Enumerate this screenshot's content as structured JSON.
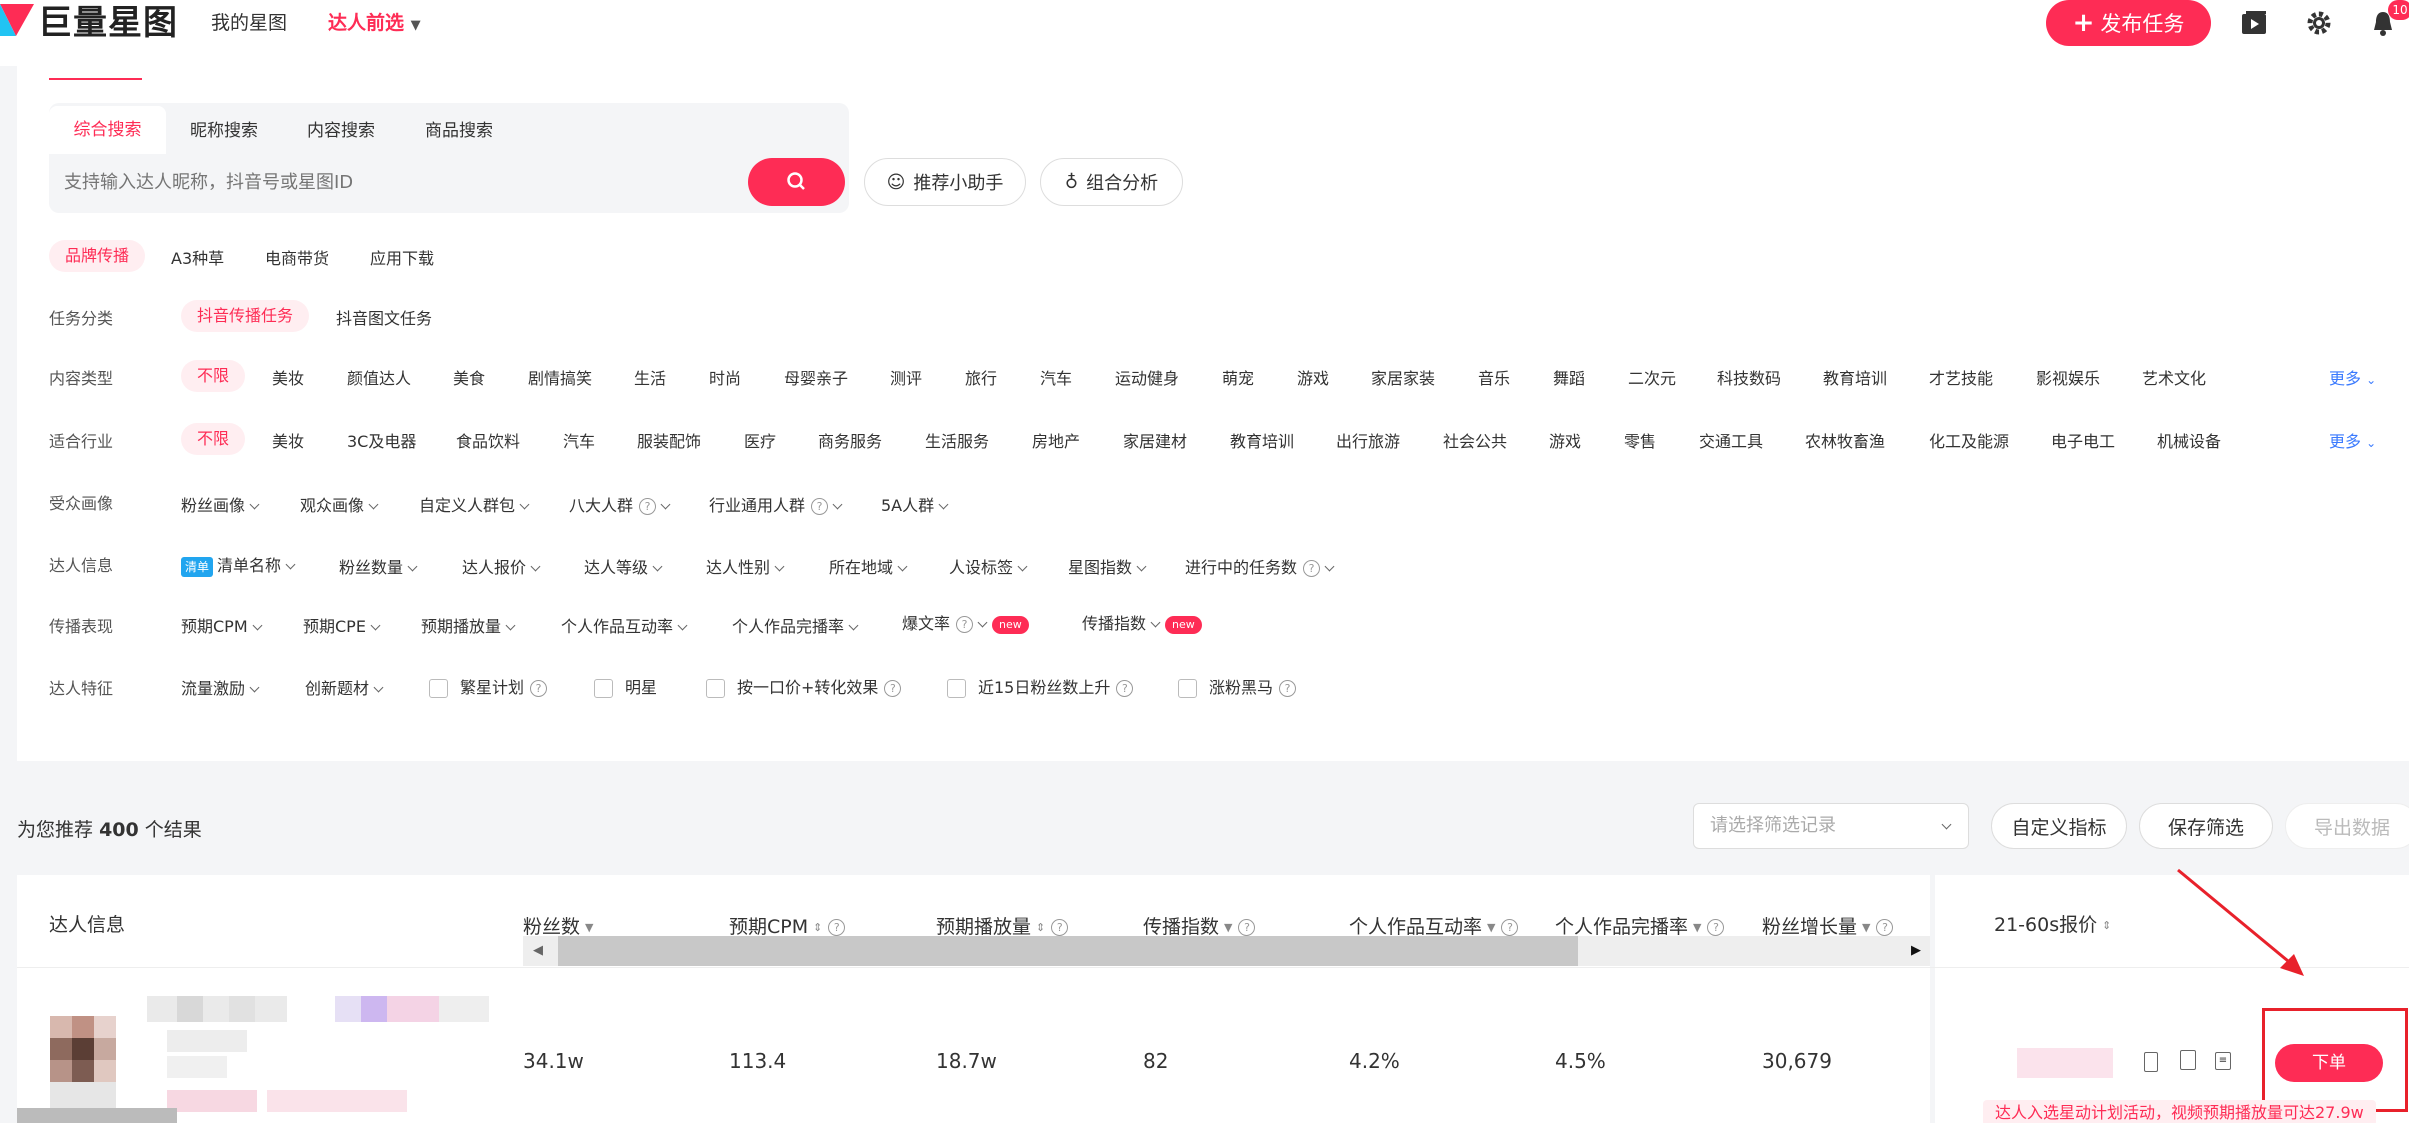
{
  "brand": {
    "logo_text": "巨量星图",
    "accent": "#fe2c55"
  },
  "nav": {
    "my_star": "我的星图",
    "talent_preselect": "达人前选",
    "publish": "发布任务",
    "notification_count": "10"
  },
  "search": {
    "tabs": [
      "综合搜索",
      "昵称搜索",
      "内容搜索",
      "商品搜索"
    ],
    "placeholder": "支持输入达人昵称，抖音号或星图ID",
    "assistant": "推荐小助手",
    "combo": "组合分析"
  },
  "categories": [
    "品牌传播",
    "A3种草",
    "电商带货",
    "应用下载"
  ],
  "task_type": {
    "label": "任务分类",
    "options": [
      "抖音传播任务",
      "抖音图文任务"
    ]
  },
  "content_type": {
    "label": "内容类型",
    "options": [
      "不限",
      "美妆",
      "颜值达人",
      "美食",
      "剧情搞笑",
      "生活",
      "时尚",
      "母婴亲子",
      "测评",
      "旅行",
      "汽车",
      "运动健身",
      "萌宠",
      "游戏",
      "家居家装",
      "音乐",
      "舞蹈",
      "二次元",
      "科技数码",
      "教育培训",
      "才艺技能",
      "影视娱乐",
      "艺术文化"
    ],
    "more": "更多"
  },
  "industry": {
    "label": "适合行业",
    "options": [
      "不限",
      "美妆",
      "3C及电器",
      "食品饮料",
      "汽车",
      "服装配饰",
      "医疗",
      "商务服务",
      "生活服务",
      "房地产",
      "家居建材",
      "教育培训",
      "出行旅游",
      "社会公共",
      "游戏",
      "零售",
      "交通工具",
      "农林牧畜渔",
      "化工及能源",
      "电子电工",
      "机械设备"
    ],
    "more": "更多"
  },
  "audience": {
    "label": "受众画像",
    "options": [
      "粉丝画像",
      "观众画像",
      "自定义人群包",
      "八大人群",
      "行业通用人群",
      "5A人群"
    ]
  },
  "talent_info": {
    "label": "达人信息",
    "list_badge": "清单",
    "options": [
      "清单名称",
      "粉丝数量",
      "达人报价",
      "达人等级",
      "达人性别",
      "所在地域",
      "人设标签",
      "星图指数",
      "进行中的任务数"
    ]
  },
  "performance": {
    "label": "传播表现",
    "options": [
      "预期CPM",
      "预期CPE",
      "预期播放量",
      "个人作品互动率",
      "个人作品完播率",
      "爆文率",
      "传播指数"
    ],
    "new": "new"
  },
  "features": {
    "label": "达人特征",
    "options": [
      "流量激励",
      "创新题材"
    ],
    "checks": [
      "繁星计划",
      "明星",
      "按一口价+转化效果",
      "近15日粉丝数上升",
      "涨粉黑马"
    ]
  },
  "results": {
    "prefix": "为您推荐",
    "count": "400",
    "suffix": "个结果",
    "record_placeholder": "请选择筛选记录",
    "custom_metric": "自定义指标",
    "save_filter": "保存筛选",
    "export": "导出数据"
  },
  "table": {
    "headers": [
      "达人信息",
      "粉丝数",
      "预期CPM",
      "预期播放量",
      "传播指数",
      "个人作品互动率",
      "个人作品完播率",
      "粉丝增长量",
      "21-60s报价"
    ],
    "row": [
      "34.1w",
      "113.4",
      "18.7w",
      "82",
      "4.2%",
      "4.5%",
      "30,679"
    ],
    "order": "下单",
    "promo": "达人入选星动计划活动，视频预期播放量可达27.9w"
  }
}
